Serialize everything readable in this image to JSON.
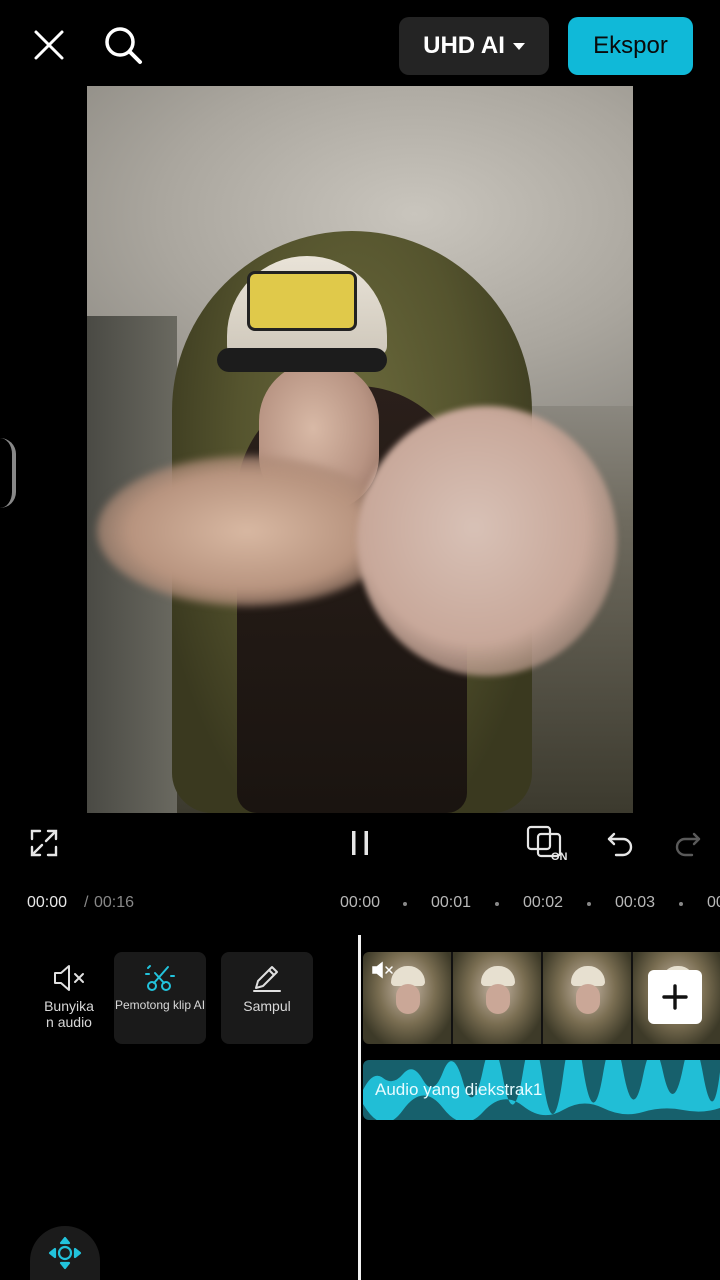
{
  "header": {
    "quality_label": "UHD AI",
    "export_label": "Ekspor"
  },
  "playback": {
    "current_time": "00:00",
    "separator": "/",
    "total_time": "00:16",
    "ticks": [
      "00:00",
      "00:01",
      "00:02",
      "00:03",
      "00"
    ]
  },
  "tools": [
    {
      "label": "Bunyika\nn audio",
      "icon": "speaker-mute-icon"
    },
    {
      "label": "Pemotong klip AI",
      "icon": "ai-scissors-icon"
    },
    {
      "label": "Sampul",
      "icon": "pencil-icon"
    }
  ],
  "timeline": {
    "audio_track_label": "Audio yang diekstrak1"
  },
  "colors": {
    "accent": "#10b9d8",
    "audio_wave": "#22c3dc",
    "audio_track_bg": "#17606c"
  }
}
